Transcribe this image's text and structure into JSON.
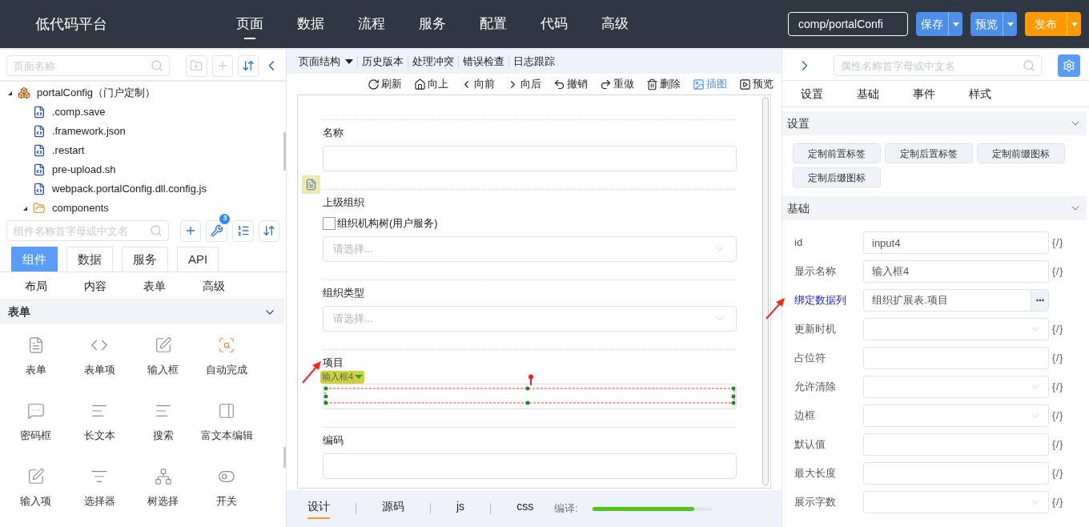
{
  "header": {
    "logo": "低代码平台",
    "nav": [
      {
        "label": "页面",
        "selected": true
      },
      {
        "label": "数据",
        "selected": false
      },
      {
        "label": "流程",
        "selected": false
      },
      {
        "label": "服务",
        "selected": false
      },
      {
        "label": "配置",
        "selected": false
      },
      {
        "label": "代码",
        "selected": false
      },
      {
        "label": "高级",
        "selected": false
      }
    ],
    "path": "comp/portalConfi",
    "buttons": [
      {
        "label": "保存",
        "kind": "primary"
      },
      {
        "label": "预览",
        "kind": "primary"
      },
      {
        "label": "发布",
        "kind": "accent"
      }
    ]
  },
  "left": {
    "page_search": {
      "placeholder": "页面名称"
    },
    "tree": [
      {
        "label": "portalConfig（门户定制）",
        "kind": "module",
        "expanded": true,
        "children": [
          {
            "label": ".comp.save",
            "kind": "file"
          },
          {
            "label": ".framework.json",
            "kind": "file"
          },
          {
            "label": ".restart",
            "kind": "file"
          },
          {
            "label": "pre-upload.sh",
            "kind": "file"
          },
          {
            "label": "webpack.portalConfig.dll.config.js",
            "kind": "file"
          },
          {
            "label": "components",
            "kind": "folder",
            "expanded": true
          }
        ]
      }
    ],
    "component_search": {
      "placeholder": "组件名称首字母或中文名"
    },
    "tool_badge": "3",
    "tabs": [
      {
        "label": "组件",
        "selected": true
      },
      {
        "label": "数据",
        "selected": false
      },
      {
        "label": "服务",
        "selected": false
      },
      {
        "label": "API",
        "selected": false
      }
    ],
    "categories": [
      "布局",
      "内容",
      "表单",
      "高级"
    ],
    "section": {
      "title": "表单",
      "expanded": true
    },
    "components": [
      {
        "label": "表单",
        "kind": "form"
      },
      {
        "label": "表单项",
        "kind": "form-item"
      },
      {
        "label": "输入框",
        "kind": "input"
      },
      {
        "label": "自动完成",
        "kind": "autocomplete"
      },
      {
        "label": "密码框",
        "kind": "password"
      },
      {
        "label": "长文本",
        "kind": "textarea"
      },
      {
        "label": "搜索",
        "kind": "search"
      },
      {
        "label": "富文本编辑",
        "kind": "richtext"
      },
      {
        "label": "输入项",
        "kind": "input"
      },
      {
        "label": "选择器",
        "kind": "select"
      },
      {
        "label": "树选择",
        "kind": "tree"
      },
      {
        "label": "开关",
        "kind": "switch"
      }
    ]
  },
  "center": {
    "menu": [
      {
        "label": "页面结构",
        "dropdown": true
      },
      {
        "label": "历史版本",
        "dropdown": false
      },
      {
        "label": "处理冲突",
        "dropdown": false
      },
      {
        "label": "错误检查",
        "dropdown": false
      },
      {
        "label": "日志跟踪",
        "dropdown": false
      }
    ],
    "actions": [
      {
        "label": "刷新",
        "kind": "refresh",
        "active": false
      },
      {
        "label": "向上",
        "kind": "up",
        "active": false
      },
      {
        "label": "向前",
        "kind": "back",
        "active": false
      },
      {
        "label": "向后",
        "kind": "forward",
        "active": false
      },
      {
        "label": "撤销",
        "kind": "undo",
        "active": false
      },
      {
        "label": "重做",
        "kind": "redo",
        "active": false
      },
      {
        "label": "删除",
        "kind": "delete",
        "active": false
      },
      {
        "label": "插图",
        "kind": "image",
        "active": true
      },
      {
        "label": "预览",
        "kind": "preview",
        "active": false
      }
    ],
    "form": [
      {
        "label": "名称",
        "kind": "input",
        "selected": false
      },
      {
        "label": "上级组织",
        "kind": "select",
        "selected": false,
        "checkbox": {
          "label": "组织机构树(用户服务)",
          "checked": false
        },
        "placeholder": "请选择..."
      },
      {
        "label": "组织类型",
        "kind": "select",
        "selected": false,
        "placeholder": "请选择..."
      },
      {
        "label": "项目",
        "kind": "input",
        "selected": true,
        "tag": "输入框4"
      },
      {
        "label": "编码",
        "kind": "input",
        "selected": false
      }
    ],
    "bottom_tabs": [
      {
        "label": "设计",
        "selected": true
      },
      {
        "label": "源码",
        "selected": false
      },
      {
        "label": "js",
        "selected": false
      },
      {
        "label": "css",
        "selected": false
      }
    ],
    "compile": {
      "label": "编译:",
      "level": 0.85
    }
  },
  "right": {
    "search": {
      "placeholder": "属性名称首字母或中文名"
    },
    "tabs": [
      "设置",
      "基础",
      "事件",
      "样式"
    ],
    "settings": {
      "title": "设置",
      "expanded": true,
      "buttons": [
        "定制前置标签",
        "定制后置标签",
        "定制前缀图标",
        "定制后缀图标"
      ]
    },
    "basic": {
      "title": "基础",
      "expanded": true,
      "properties": [
        {
          "label": "id",
          "kind": "input",
          "value": "input4",
          "expression": "{/}",
          "highlighted": false
        },
        {
          "label": "显示名称",
          "kind": "input",
          "value": "输入框4",
          "expression": "{/}",
          "highlighted": false
        },
        {
          "label": "绑定数据列",
          "kind": "picker",
          "value": "组织扩展表.项目",
          "highlighted": true
        },
        {
          "label": "更新时机",
          "kind": "select",
          "expression": "{/}",
          "highlighted": false
        },
        {
          "label": "占位符",
          "kind": "input",
          "expression": "{/}",
          "highlighted": false
        },
        {
          "label": "允许清除",
          "kind": "select",
          "expression": "{/}",
          "highlighted": false
        },
        {
          "label": "边框",
          "kind": "select",
          "expression": "{/}",
          "highlighted": false
        },
        {
          "label": "默认值",
          "kind": "input",
          "expression": "{/}",
          "highlighted": false
        },
        {
          "label": "最大长度",
          "kind": "input",
          "expression": "{/}",
          "highlighted": false
        },
        {
          "label": "展示字数",
          "kind": "select",
          "expression": "{/}",
          "highlighted": false
        }
      ]
    }
  }
}
